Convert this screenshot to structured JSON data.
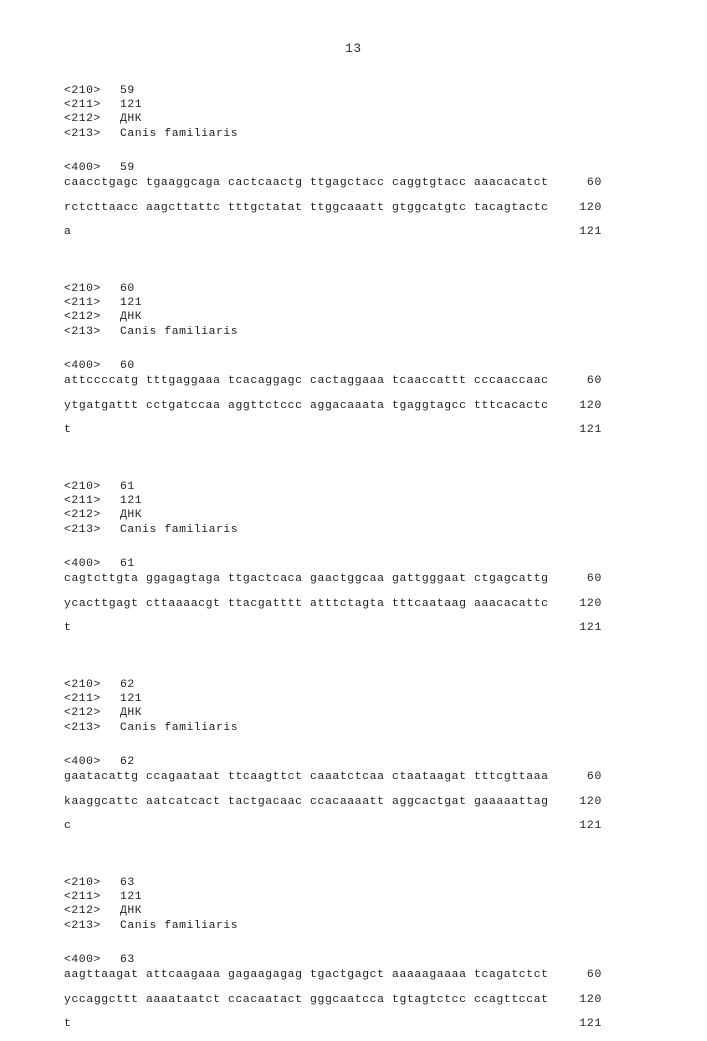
{
  "page": {
    "number": "13"
  },
  "labels": {
    "tag_210": "<210>",
    "tag_211": "<211>",
    "tag_212": "<212>",
    "tag_213": "<213>",
    "tag_400": "<400>"
  },
  "sequences": [
    {
      "id_210": "59",
      "length_211": "121",
      "molecule_type_212": "ДНК",
      "organism_213": "Canis familiaris",
      "seq_id_400": "59",
      "lines": [
        {
          "residues": "caacctgagc tgaaggcaga cactcaactg ttgagctacc caggtgtacc aaacacatct",
          "count": "60"
        },
        {
          "residues": "rctcttaacc aagcttattc tttgctatat ttggcaaatt gtggcatgtc tacagtactc",
          "count": "120"
        },
        {
          "residues": "a",
          "count": "121"
        }
      ]
    },
    {
      "id_210": "60",
      "length_211": "121",
      "molecule_type_212": "ДНК",
      "organism_213": "Canis familiaris",
      "seq_id_400": "60",
      "lines": [
        {
          "residues": "attccccatg tttgaggaaa tcacaggagc cactaggaaa tcaaccattt cccaaccaac",
          "count": "60"
        },
        {
          "residues": "ytgatgattt cctgatccaa aggttctccc aggacaaata tgaggtagcc tttcacactc",
          "count": "120"
        },
        {
          "residues": "t",
          "count": "121"
        }
      ]
    },
    {
      "id_210": "61",
      "length_211": "121",
      "molecule_type_212": "ДНК",
      "organism_213": "Canis familiaris",
      "seq_id_400": "61",
      "lines": [
        {
          "residues": "cagtcttgta ggagagtaga ttgactcaca gaactggcaa gattgggaat ctgagcattg",
          "count": "60"
        },
        {
          "residues": "ycacttgagt cttaaaacgt ttacgatttt atttctagta tttcaataag aaacacattc",
          "count": "120"
        },
        {
          "residues": "t",
          "count": "121"
        }
      ]
    },
    {
      "id_210": "62",
      "length_211": "121",
      "molecule_type_212": "ДНК",
      "organism_213": "Canis familiaris",
      "seq_id_400": "62",
      "lines": [
        {
          "residues": "gaatacattg ccagaataat ttcaagttct caaatctcaa ctaataagat tttcgttaaa",
          "count": "60"
        },
        {
          "residues": "kaaggcattc aatcatcact tactgacaac ccacaaaatt aggcactgat gaaaaattag",
          "count": "120"
        },
        {
          "residues": "c",
          "count": "121"
        }
      ]
    },
    {
      "id_210": "63",
      "length_211": "121",
      "molecule_type_212": "ДНК",
      "organism_213": "Canis familiaris",
      "seq_id_400": "63",
      "lines": [
        {
          "residues": "aagttaagat attcaagaaa gagaagagag tgactgagct aaaaagaaaa tcagatctct",
          "count": "60"
        },
        {
          "residues": "yccaggcttt aaaataatct ccacaatact gggcaatcca tgtagtctcc ccagttccat",
          "count": "120"
        },
        {
          "residues": "t",
          "count": "121"
        }
      ]
    }
  ]
}
